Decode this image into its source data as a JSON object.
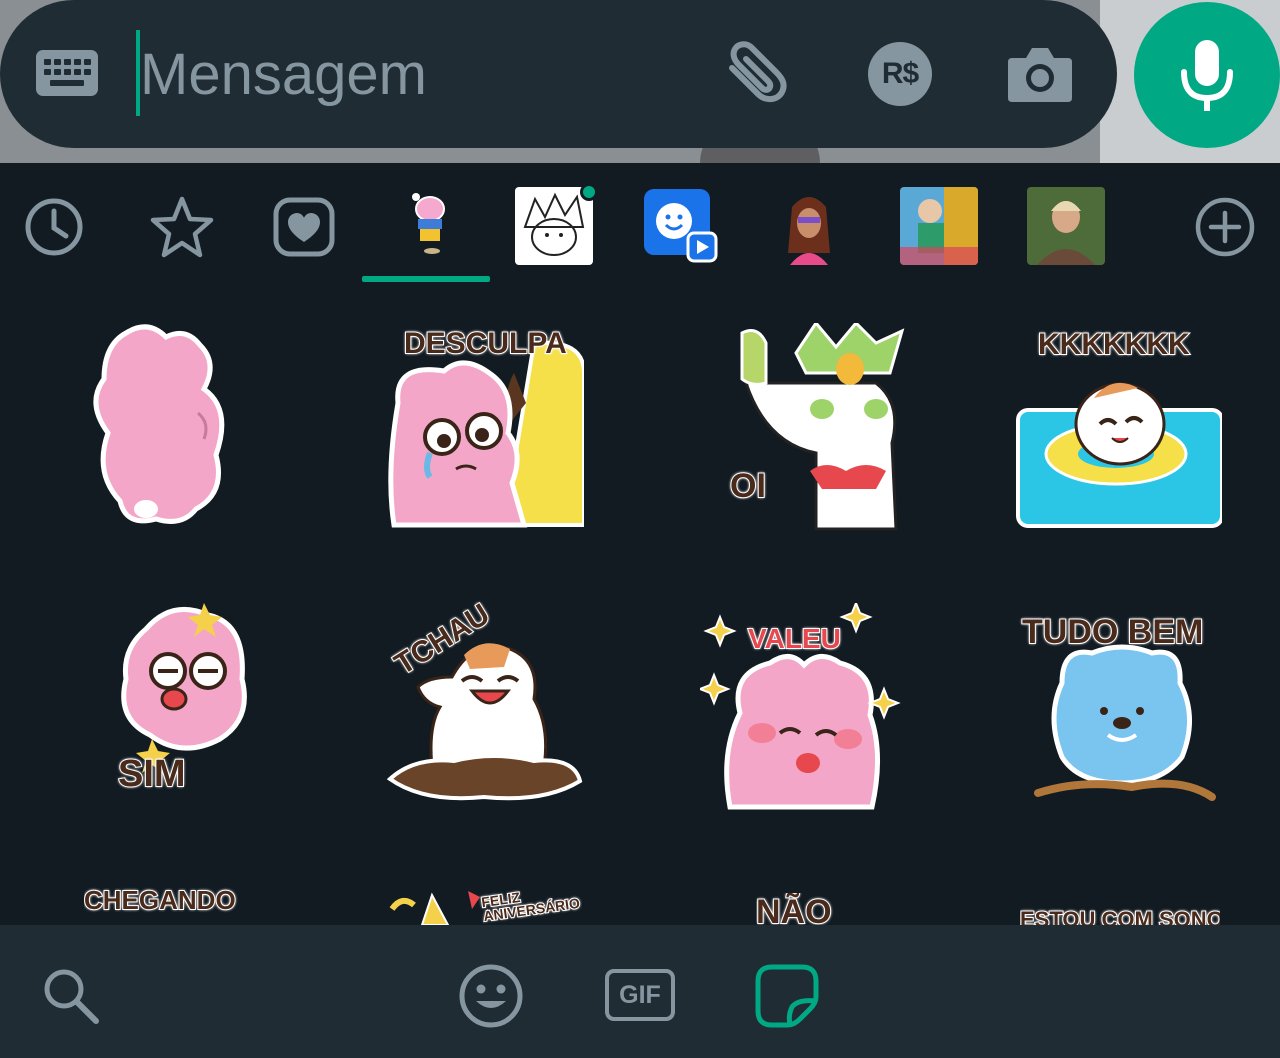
{
  "input": {
    "placeholder": "Mensagem",
    "keyboard_icon": "keyboard-icon",
    "attach_icon": "paperclip-icon",
    "payment_label": "R$",
    "camera_icon": "camera-icon",
    "mic_icon": "microphone-icon"
  },
  "tabs": {
    "recent_icon": "clock-icon",
    "favorites_icon": "star-icon",
    "liked_icon": "heart-icon",
    "add_icon": "plus-circle-icon",
    "selected_index": 3
  },
  "stickers": {
    "row1": [
      "",
      "DESCULPA",
      "OI",
      "KKKKKKK"
    ],
    "row2": [
      "SIM",
      "TCHAU",
      "VALEU",
      "TUDO BEM"
    ],
    "row3": [
      "CHEGANDO",
      "FELIZ ANIVERSÁRIO",
      "NÃO",
      "ESTOU COM SONO"
    ]
  },
  "bottom": {
    "search_icon": "search-icon",
    "emoji_icon": "emoji-icon",
    "gif_label": "GIF",
    "sticker_icon": "sticker-icon"
  },
  "colors": {
    "accent": "#00a884",
    "bar": "#1f2c34",
    "panel": "#121b22",
    "icon": "#8696a0"
  }
}
